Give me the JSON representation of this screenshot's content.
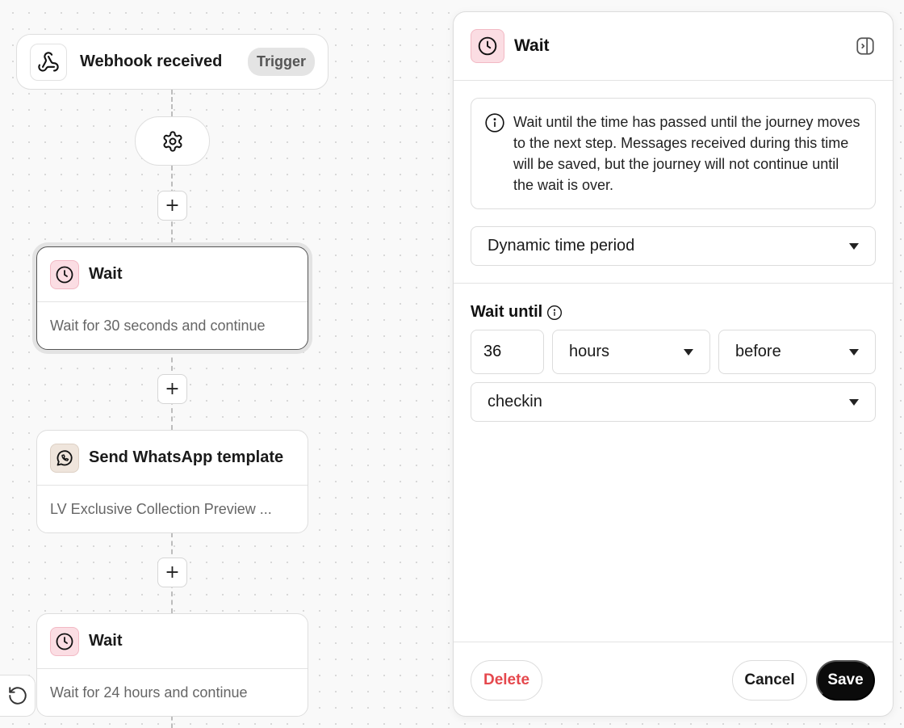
{
  "canvas": {
    "trigger_node": {
      "title": "Webhook received",
      "badge": "Trigger",
      "icon": "webhook-icon"
    },
    "settings_node": {
      "icon": "gear-icon"
    },
    "add_step_label": "+",
    "steps": [
      {
        "title": "Wait",
        "description": "Wait for 30 seconds and continue",
        "icon": "clock-icon",
        "selected": true
      },
      {
        "title": "Send WhatsApp template",
        "description": "LV Exclusive Collection Preview ...",
        "icon": "whatsapp-icon",
        "selected": false
      },
      {
        "title": "Wait",
        "description": "Wait for 24 hours and continue",
        "icon": "clock-icon",
        "selected": false
      }
    ],
    "undo_icon": "undo-icon"
  },
  "panel": {
    "title": "Wait",
    "icon": "clock-icon",
    "collapse_icon": "panel-collapse-icon",
    "info_text": "Wait until the time has passed until the journey moves to the next step. Messages received during this time will be saved, but the journey will not continue until the wait is over.",
    "mode_select": {
      "value": "Dynamic time period"
    },
    "wait_until_label": "Wait until",
    "amount": "36",
    "unit_select": {
      "value": "hours"
    },
    "direction_select": {
      "value": "before"
    },
    "field_select": {
      "value": "checkin"
    },
    "buttons": {
      "delete": "Delete",
      "cancel": "Cancel",
      "save": "Save"
    }
  },
  "colors": {
    "accent_pink": "#fbdde3",
    "danger": "#e5484d",
    "primary_button": "#0b0b0b"
  }
}
